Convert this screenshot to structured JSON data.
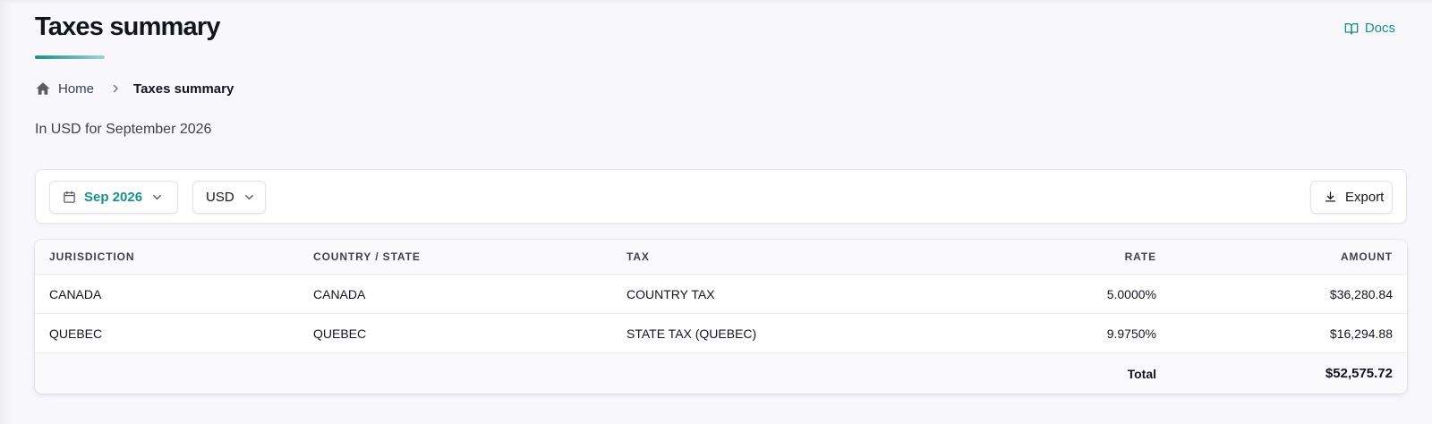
{
  "header": {
    "title": "Taxes summary",
    "docs_label": "Docs"
  },
  "breadcrumb": {
    "home_label": "Home",
    "current_label": "Taxes summary"
  },
  "subtitle": "In USD for September 2026",
  "toolbar": {
    "period_label": "Sep 2026",
    "currency_label": "USD",
    "export_label": "Export"
  },
  "table": {
    "columns": [
      "JURISDICTION",
      "COUNTRY / STATE",
      "TAX",
      "RATE",
      "AMOUNT"
    ],
    "rows": [
      [
        "CANADA",
        "CANADA",
        "COUNTRY TAX",
        "5.0000%",
        "$36,280.84"
      ],
      [
        "QUEBEC",
        "QUEBEC",
        "STATE TAX (QUEBEC)",
        "9.9750%",
        "$16,294.88"
      ]
    ],
    "total_label": "Total",
    "total_value": "$52,575.72"
  },
  "icons": {
    "docs": "book-open-icon",
    "home": "home-icon",
    "separator": "chevron-right-icon",
    "period": "calendar-icon",
    "dropdown": "chevron-down-icon",
    "export": "download-icon"
  },
  "colors": {
    "accent": "#1a8f8a",
    "background": "#f8f8fc",
    "text": "#14141f"
  }
}
